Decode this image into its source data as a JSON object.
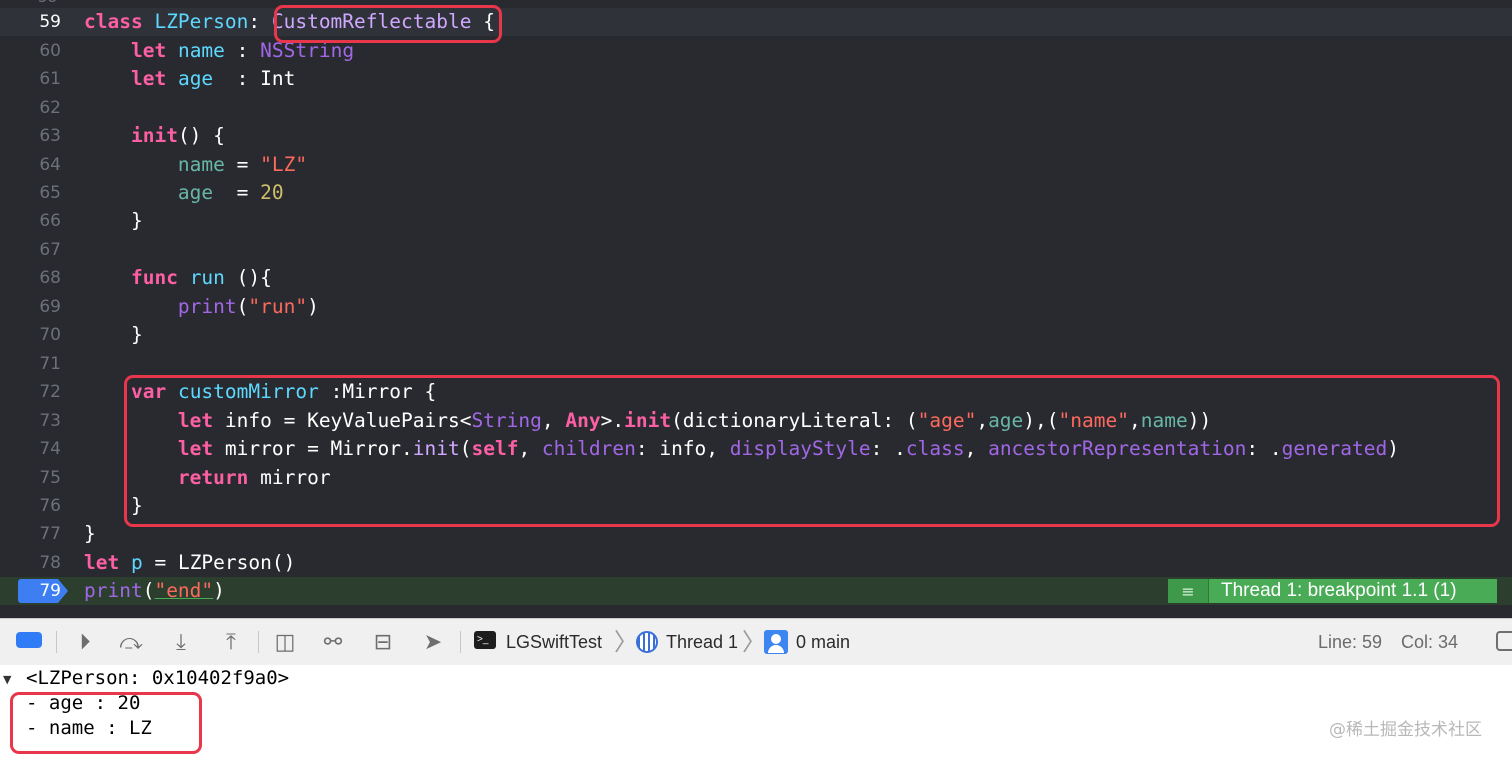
{
  "editor": {
    "partial_top_line": "58",
    "lines": [
      {
        "num": "59",
        "current": true
      },
      {
        "num": "60"
      },
      {
        "num": "61"
      },
      {
        "num": "62"
      },
      {
        "num": "63"
      },
      {
        "num": "64"
      },
      {
        "num": "65"
      },
      {
        "num": "66"
      },
      {
        "num": "67"
      },
      {
        "num": "68"
      },
      {
        "num": "69"
      },
      {
        "num": "70"
      },
      {
        "num": "71"
      },
      {
        "num": "72"
      },
      {
        "num": "73"
      },
      {
        "num": "74"
      },
      {
        "num": "75"
      },
      {
        "num": "76"
      },
      {
        "num": "77"
      },
      {
        "num": "78"
      },
      {
        "num": "79",
        "breakpoint": true
      }
    ],
    "tokens": {
      "l59": [
        "class",
        " ",
        "LZPerson",
        ": ",
        "CustomReflectable",
        " {"
      ],
      "l60": [
        "    ",
        "let",
        " ",
        "name",
        " : ",
        "NSString"
      ],
      "l61": [
        "    ",
        "let",
        " ",
        "age",
        "  : Int"
      ],
      "l63": [
        "    ",
        "init",
        "() {"
      ],
      "l64": [
        "        ",
        "name",
        " = ",
        "\"LZ\""
      ],
      "l65": [
        "        ",
        "age",
        "  = ",
        "20"
      ],
      "l66": [
        "    }"
      ],
      "l68": [
        "    ",
        "func",
        " ",
        "run",
        " (){"
      ],
      "l69": [
        "        ",
        "print",
        "(",
        "\"run\"",
        ")"
      ],
      "l70": [
        "    }"
      ],
      "l72": [
        "    ",
        "var",
        " ",
        "customMirror",
        " :Mirror {"
      ],
      "l73": [
        "        ",
        "let",
        " info = KeyValuePairs<",
        "String",
        ", ",
        "Any",
        ">.",
        "init",
        "(dictionaryLiteral: (",
        "\"age\"",
        ",",
        "age",
        "),(",
        "\"name\"",
        ",",
        "name",
        "))"
      ],
      "l74": [
        "        ",
        "let",
        " mirror = Mirror.",
        "init",
        "(",
        "self",
        ", ",
        "children",
        ": info, ",
        "displayStyle",
        ": .",
        "class",
        ", ",
        "ancestorRepresentation",
        ": .",
        "generated",
        ")"
      ],
      "l75": [
        "        ",
        "return",
        " mirror"
      ],
      "l76": [
        "    }"
      ],
      "l77": [
        "}"
      ],
      "l78": [
        "let",
        " ",
        "p",
        " = LZPerson()"
      ],
      "l79": [
        "print",
        "(",
        "\"end\"",
        ")"
      ]
    },
    "breakpoint_label": "Thread 1: breakpoint 1.1 (1)",
    "breakpoint_icon": "list-icon"
  },
  "debug_bar": {
    "buttons": [
      "breakpoints-toggle-icon",
      "continue-icon",
      "step-over-icon",
      "step-into-icon",
      "step-out-icon",
      "view-hierarchy-icon",
      "memory-graph-icon",
      "environment-overrides-icon",
      "simulate-location-icon"
    ],
    "target": "LGSwiftTest",
    "thread": "Thread 1",
    "frame": "0 main",
    "line_label": "Line: 59",
    "col_label": "Col: 34"
  },
  "console": {
    "lines": [
      "<LZPerson: 0x10402f9a0>",
      "- age : 20",
      "- name : LZ"
    ],
    "watermark": "@稀土掘金技术社区"
  },
  "colors": {
    "editor_bg": "#292a30",
    "keyword": "#fc5fa3",
    "string": "#fc6a5d",
    "number": "#d0bf69",
    "highlight_box": "#e8364a",
    "breakpoint": "#3d7ff2",
    "breakpoint_label_bg": "#4aab56"
  }
}
